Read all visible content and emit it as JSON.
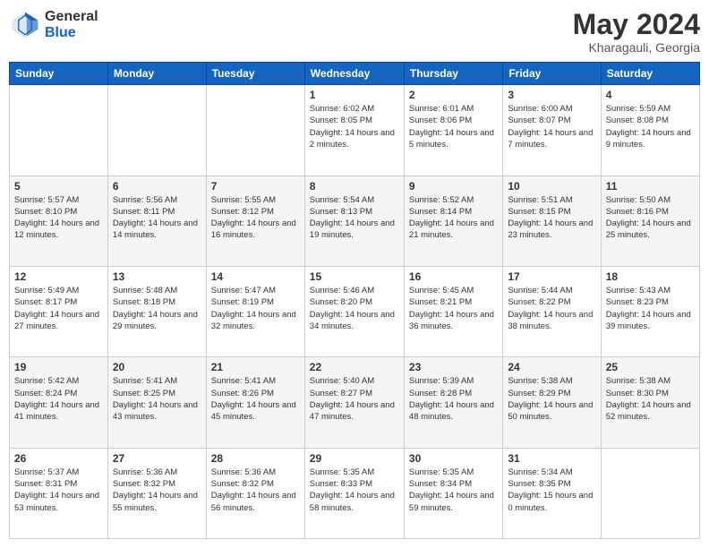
{
  "logo": {
    "general": "General",
    "blue": "Blue"
  },
  "title": "May 2024",
  "location": "Kharagauli, Georgia",
  "weekdays": [
    "Sunday",
    "Monday",
    "Tuesday",
    "Wednesday",
    "Thursday",
    "Friday",
    "Saturday"
  ],
  "weeks": [
    [
      {
        "day": "",
        "sunrise": "",
        "sunset": "",
        "daylight": ""
      },
      {
        "day": "",
        "sunrise": "",
        "sunset": "",
        "daylight": ""
      },
      {
        "day": "",
        "sunrise": "",
        "sunset": "",
        "daylight": ""
      },
      {
        "day": "1",
        "sunrise": "Sunrise: 6:02 AM",
        "sunset": "Sunset: 8:05 PM",
        "daylight": "Daylight: 14 hours and 2 minutes."
      },
      {
        "day": "2",
        "sunrise": "Sunrise: 6:01 AM",
        "sunset": "Sunset: 8:06 PM",
        "daylight": "Daylight: 14 hours and 5 minutes."
      },
      {
        "day": "3",
        "sunrise": "Sunrise: 6:00 AM",
        "sunset": "Sunset: 8:07 PM",
        "daylight": "Daylight: 14 hours and 7 minutes."
      },
      {
        "day": "4",
        "sunrise": "Sunrise: 5:59 AM",
        "sunset": "Sunset: 8:08 PM",
        "daylight": "Daylight: 14 hours and 9 minutes."
      }
    ],
    [
      {
        "day": "5",
        "sunrise": "Sunrise: 5:57 AM",
        "sunset": "Sunset: 8:10 PM",
        "daylight": "Daylight: 14 hours and 12 minutes."
      },
      {
        "day": "6",
        "sunrise": "Sunrise: 5:56 AM",
        "sunset": "Sunset: 8:11 PM",
        "daylight": "Daylight: 14 hours and 14 minutes."
      },
      {
        "day": "7",
        "sunrise": "Sunrise: 5:55 AM",
        "sunset": "Sunset: 8:12 PM",
        "daylight": "Daylight: 14 hours and 16 minutes."
      },
      {
        "day": "8",
        "sunrise": "Sunrise: 5:54 AM",
        "sunset": "Sunset: 8:13 PM",
        "daylight": "Daylight: 14 hours and 19 minutes."
      },
      {
        "day": "9",
        "sunrise": "Sunrise: 5:52 AM",
        "sunset": "Sunset: 8:14 PM",
        "daylight": "Daylight: 14 hours and 21 minutes."
      },
      {
        "day": "10",
        "sunrise": "Sunrise: 5:51 AM",
        "sunset": "Sunset: 8:15 PM",
        "daylight": "Daylight: 14 hours and 23 minutes."
      },
      {
        "day": "11",
        "sunrise": "Sunrise: 5:50 AM",
        "sunset": "Sunset: 8:16 PM",
        "daylight": "Daylight: 14 hours and 25 minutes."
      }
    ],
    [
      {
        "day": "12",
        "sunrise": "Sunrise: 5:49 AM",
        "sunset": "Sunset: 8:17 PM",
        "daylight": "Daylight: 14 hours and 27 minutes."
      },
      {
        "day": "13",
        "sunrise": "Sunrise: 5:48 AM",
        "sunset": "Sunset: 8:18 PM",
        "daylight": "Daylight: 14 hours and 29 minutes."
      },
      {
        "day": "14",
        "sunrise": "Sunrise: 5:47 AM",
        "sunset": "Sunset: 8:19 PM",
        "daylight": "Daylight: 14 hours and 32 minutes."
      },
      {
        "day": "15",
        "sunrise": "Sunrise: 5:46 AM",
        "sunset": "Sunset: 8:20 PM",
        "daylight": "Daylight: 14 hours and 34 minutes."
      },
      {
        "day": "16",
        "sunrise": "Sunrise: 5:45 AM",
        "sunset": "Sunset: 8:21 PM",
        "daylight": "Daylight: 14 hours and 36 minutes."
      },
      {
        "day": "17",
        "sunrise": "Sunrise: 5:44 AM",
        "sunset": "Sunset: 8:22 PM",
        "daylight": "Daylight: 14 hours and 38 minutes."
      },
      {
        "day": "18",
        "sunrise": "Sunrise: 5:43 AM",
        "sunset": "Sunset: 8:23 PM",
        "daylight": "Daylight: 14 hours and 39 minutes."
      }
    ],
    [
      {
        "day": "19",
        "sunrise": "Sunrise: 5:42 AM",
        "sunset": "Sunset: 8:24 PM",
        "daylight": "Daylight: 14 hours and 41 minutes."
      },
      {
        "day": "20",
        "sunrise": "Sunrise: 5:41 AM",
        "sunset": "Sunset: 8:25 PM",
        "daylight": "Daylight: 14 hours and 43 minutes."
      },
      {
        "day": "21",
        "sunrise": "Sunrise: 5:41 AM",
        "sunset": "Sunset: 8:26 PM",
        "daylight": "Daylight: 14 hours and 45 minutes."
      },
      {
        "day": "22",
        "sunrise": "Sunrise: 5:40 AM",
        "sunset": "Sunset: 8:27 PM",
        "daylight": "Daylight: 14 hours and 47 minutes."
      },
      {
        "day": "23",
        "sunrise": "Sunrise: 5:39 AM",
        "sunset": "Sunset: 8:28 PM",
        "daylight": "Daylight: 14 hours and 48 minutes."
      },
      {
        "day": "24",
        "sunrise": "Sunrise: 5:38 AM",
        "sunset": "Sunset: 8:29 PM",
        "daylight": "Daylight: 14 hours and 50 minutes."
      },
      {
        "day": "25",
        "sunrise": "Sunrise: 5:38 AM",
        "sunset": "Sunset: 8:30 PM",
        "daylight": "Daylight: 14 hours and 52 minutes."
      }
    ],
    [
      {
        "day": "26",
        "sunrise": "Sunrise: 5:37 AM",
        "sunset": "Sunset: 8:31 PM",
        "daylight": "Daylight: 14 hours and 53 minutes."
      },
      {
        "day": "27",
        "sunrise": "Sunrise: 5:36 AM",
        "sunset": "Sunset: 8:32 PM",
        "daylight": "Daylight: 14 hours and 55 minutes."
      },
      {
        "day": "28",
        "sunrise": "Sunrise: 5:36 AM",
        "sunset": "Sunset: 8:32 PM",
        "daylight": "Daylight: 14 hours and 56 minutes."
      },
      {
        "day": "29",
        "sunrise": "Sunrise: 5:35 AM",
        "sunset": "Sunset: 8:33 PM",
        "daylight": "Daylight: 14 hours and 58 minutes."
      },
      {
        "day": "30",
        "sunrise": "Sunrise: 5:35 AM",
        "sunset": "Sunset: 8:34 PM",
        "daylight": "Daylight: 14 hours and 59 minutes."
      },
      {
        "day": "31",
        "sunrise": "Sunrise: 5:34 AM",
        "sunset": "Sunset: 8:35 PM",
        "daylight": "Daylight: 15 hours and 0 minutes."
      },
      {
        "day": "",
        "sunrise": "",
        "sunset": "",
        "daylight": ""
      }
    ]
  ]
}
